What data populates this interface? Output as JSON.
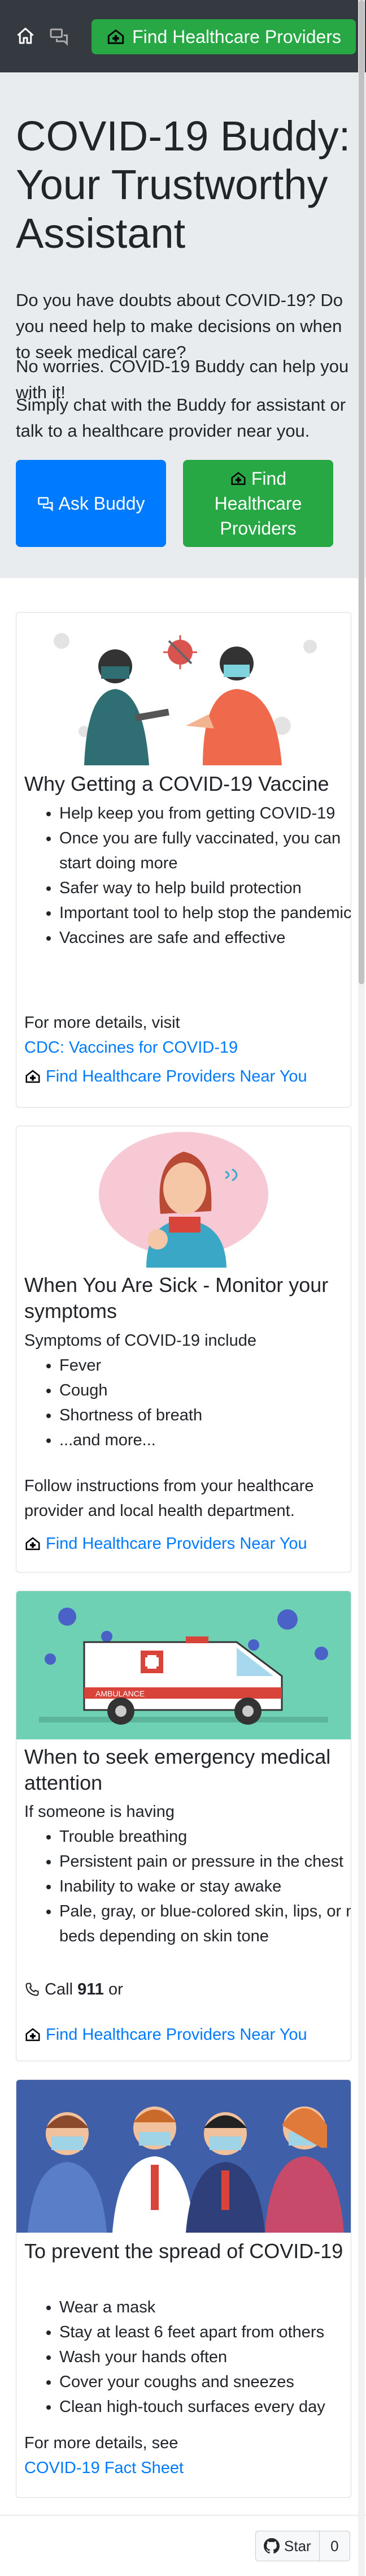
{
  "navbar": {
    "home_icon": "home-icon",
    "chat_icon": "chat-icon",
    "cta_label": "Find Healthcare Providers"
  },
  "hero": {
    "title": "COVID-19 Buddy: Your Trustworthy Assistant",
    "lead1": "Do you have doubts about COVID-19? Do you need help to make decisions on when to seek medical care?",
    "lead2": "No worries. COVID-19 Buddy can help you with it!",
    "lead3": "Simply chat with the Buddy for assistant or talk to a healthcare provider near you.",
    "ask_button": "Ask Buddy",
    "find_button": "Find Healthcare Providers"
  },
  "cards": [
    {
      "title": "Why Getting a COVID-19 Vaccine",
      "items": [
        "Help keep you from getting COVID-19",
        "Once you are fully vaccinated, you can start doing more",
        "Safer way to help build protection",
        "Important tool to help stop the pandemic",
        "Vaccines are safe and effective"
      ],
      "more_text": "For more details, visit",
      "more_link": "CDC: Vaccines for COVID-19",
      "find_link": "Find Healthcare Providers Near You"
    },
    {
      "title": "When You Are Sick - Monitor your symptoms",
      "intro": "Symptoms of COVID-19 include",
      "items": [
        "Fever",
        "Cough",
        "Shortness of breath",
        "...and more..."
      ],
      "follow": "Follow instructions from your healthcare provider and local health department.",
      "find_link": "Find Healthcare Providers Near You"
    },
    {
      "title": "When to seek emergency medical attention",
      "intro": "If someone is having",
      "items": [
        "Trouble breathing",
        "Persistent pain or pressure in the chest",
        "Inability to wake or stay awake",
        "Pale, gray, or blue-colored skin, lips, or nail beds depending on skin tone"
      ],
      "call_prefix": "Call",
      "call_number": "911",
      "call_suffix": "or",
      "find_link": "Find Healthcare Providers Near You",
      "ambulance_text": "AMBULANCE"
    },
    {
      "title": "To prevent the spread of COVID-19",
      "items": [
        "Wear a mask",
        "Stay at least 6 feet apart from others",
        "Wash your hands often",
        "Cover your coughs and sneezes",
        "Clean high-touch surfaces every day"
      ],
      "more_text": "For more details, see",
      "more_link": "COVID-19 Fact Sheet"
    }
  ],
  "github": {
    "star_label": "Star",
    "count": "0"
  },
  "colors": {
    "navbar": "#343a40",
    "primary": "#007bff",
    "success": "#28a745",
    "hero_bg": "#e9ecef"
  }
}
